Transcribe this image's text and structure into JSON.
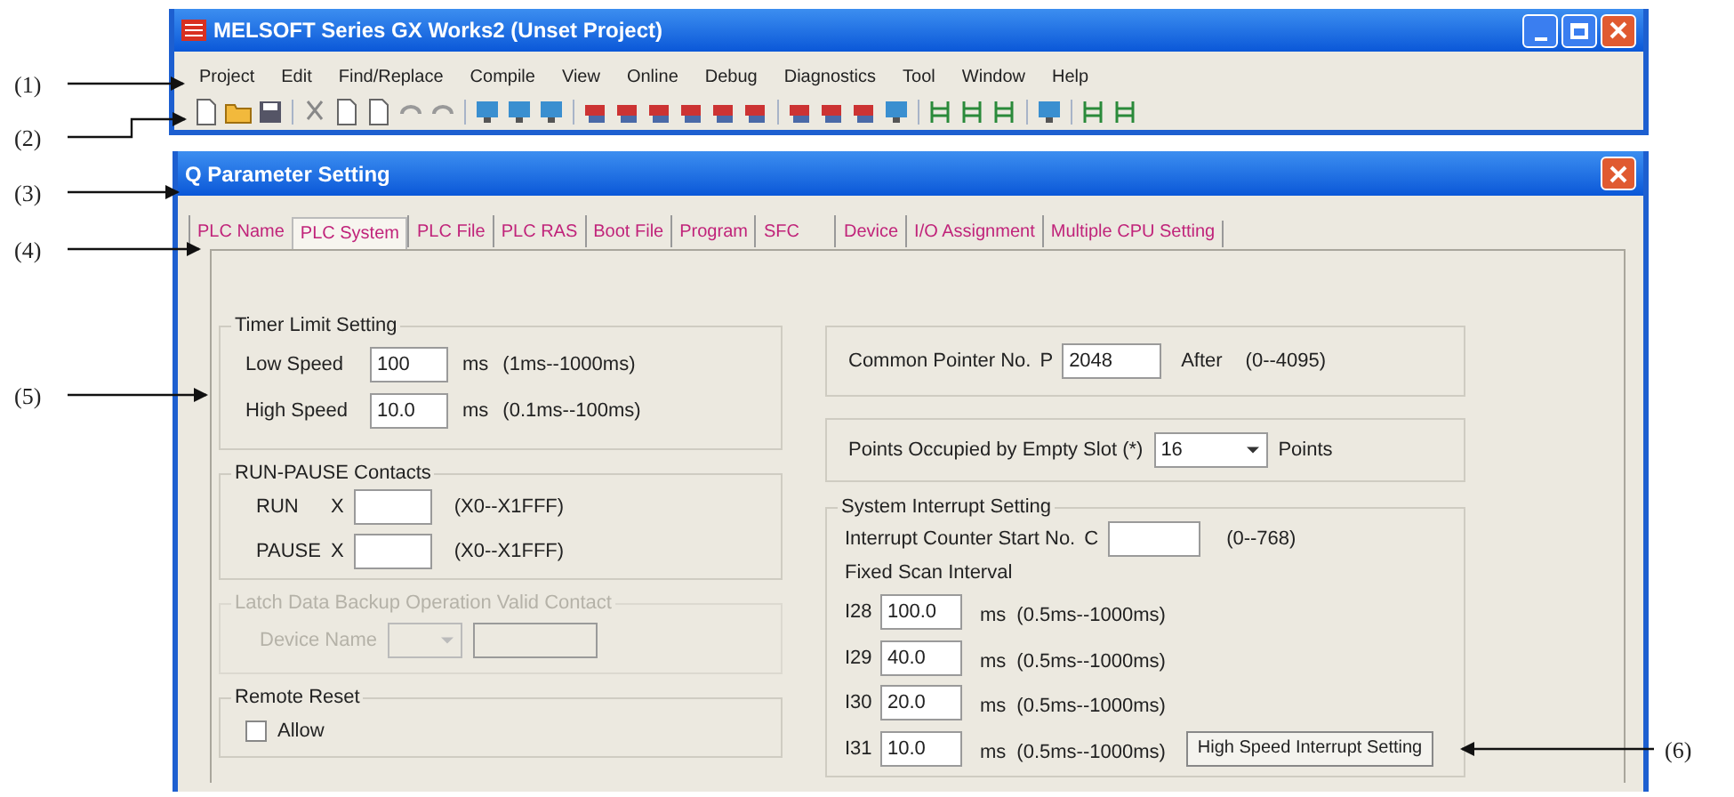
{
  "callouts": [
    {
      "label": "(1)"
    },
    {
      "label": "(2)"
    },
    {
      "label": "(3)"
    },
    {
      "label": "(4)"
    },
    {
      "label": "(5)"
    },
    {
      "label": "(6)"
    }
  ],
  "main_window": {
    "title": "MELSOFT Series GX Works2 (Unset Project)",
    "menu": [
      "Project",
      "Edit",
      "Find/Replace",
      "Compile",
      "View",
      "Online",
      "Debug",
      "Diagnostics",
      "Tool",
      "Window",
      "Help"
    ]
  },
  "dialog": {
    "title": "Q Parameter Setting",
    "tabs": [
      {
        "label": "PLC Name",
        "selected": false
      },
      {
        "label": "PLC System",
        "selected": true
      },
      {
        "label": "PLC File",
        "selected": false
      },
      {
        "label": "PLC RAS",
        "selected": false
      },
      {
        "label": "Boot File",
        "selected": false
      },
      {
        "label": "Program",
        "selected": false
      },
      {
        "label": "SFC",
        "selected": false
      },
      {
        "label": "Device",
        "selected": false
      },
      {
        "label": "I/O Assignment",
        "selected": false
      },
      {
        "label": "Multiple CPU Setting",
        "selected": false
      }
    ],
    "timer_limit": {
      "title": "Timer Limit Setting",
      "rows": [
        {
          "label": "Low Speed",
          "value": "100",
          "unit": "ms",
          "range": "(1ms--1000ms)"
        },
        {
          "label": "High Speed",
          "value": "10.0",
          "unit": "ms",
          "range": "(0.1ms--100ms)"
        }
      ]
    },
    "run_pause": {
      "title": "RUN-PAUSE Contacts",
      "rows": [
        {
          "label": "RUN",
          "prefix": "X",
          "range": "(X0--X1FFF)"
        },
        {
          "label": "PAUSE",
          "prefix": "X",
          "range": "(X0--X1FFF)"
        }
      ]
    },
    "latch": {
      "title": "Latch Data Backup Operation Valid Contact",
      "disabled": true,
      "device_label": "Device Name"
    },
    "remote_reset": {
      "title": "Remote Reset",
      "checkbox": {
        "label": "Allow",
        "checked": false
      }
    },
    "common_pointer": {
      "label": "Common Pointer No.",
      "prefix": "P",
      "value": "2048",
      "suffix": "After",
      "range": "(0--4095)"
    },
    "empty_slot": {
      "label": "Points Occupied by Empty Slot (*)",
      "value": "16",
      "unit": "Points"
    },
    "interrupt": {
      "title": "System Interrupt Setting",
      "counter_label": "Interrupt Counter Start No.",
      "counter_prefix": "C",
      "counter_range": "(0--768)",
      "fixed_label": "Fixed Scan Interval",
      "rows": [
        {
          "label": "I28",
          "value": "100.0",
          "unit": "ms",
          "range": "(0.5ms--1000ms)"
        },
        {
          "label": "I29",
          "value": "40.0",
          "unit": "ms",
          "range": "(0.5ms--1000ms)"
        },
        {
          "label": "I30",
          "value": "20.0",
          "unit": "ms",
          "range": "(0.5ms--1000ms)"
        },
        {
          "label": "I31",
          "value": "10.0",
          "unit": "ms",
          "range": "(0.5ms--1000ms)"
        }
      ],
      "button": "High Speed Interrupt Setting"
    }
  }
}
